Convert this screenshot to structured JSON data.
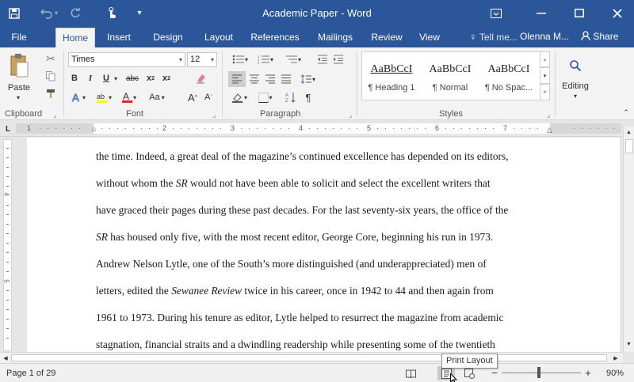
{
  "titlebar": {
    "title": "Academic Paper - Word",
    "save_icon": "save-icon",
    "undo_icon": "undo-icon",
    "redo_icon": "redo-icon",
    "touch_icon": "touch-mode-icon",
    "customize_icon": "customize-toolbar-icon",
    "ribbon_display_icon": "ribbon-display-options-icon"
  },
  "tabs": [
    {
      "label": "File"
    },
    {
      "label": "Home"
    },
    {
      "label": "Insert"
    },
    {
      "label": "Design"
    },
    {
      "label": "Layout"
    },
    {
      "label": "References"
    },
    {
      "label": "Mailings"
    },
    {
      "label": "Review"
    },
    {
      "label": "View"
    }
  ],
  "tellme": "Tell me...",
  "account": "Olenna M...",
  "share": "Share",
  "ribbon": {
    "clipboard": {
      "paste": "Paste",
      "label": "Clipboard"
    },
    "font": {
      "name": "Times",
      "size": "12",
      "label": "Font",
      "bold": "B",
      "italic": "I",
      "underline": "U",
      "strike": "abc",
      "subscript": "x",
      "superscript": "x",
      "case": "Aa",
      "grow": "A",
      "shrink": "A"
    },
    "paragraph": {
      "label": "Paragraph"
    },
    "styles": {
      "label": "Styles",
      "items": [
        {
          "sample": "AaBbCcI",
          "name": "¶ Heading 1"
        },
        {
          "sample": "AaBbCcI",
          "name": "¶ Normal"
        },
        {
          "sample": "AaBbCcI",
          "name": "¶ No Spac..."
        }
      ]
    },
    "editing": {
      "label": "Editing"
    }
  },
  "ruler": {
    "numbers": [
      "1",
      "2",
      "3",
      "4",
      "5",
      "6",
      "7"
    ]
  },
  "vruler": {
    "numbers": [
      "4",
      "5"
    ]
  },
  "document": {
    "lines": [
      {
        "parts": [
          "the time. Indeed, a great deal of the magazine’s continued excellence has depended on its editors,"
        ]
      },
      {
        "parts": [
          "without whom the ",
          "SR",
          " would not have been able to solicit and select the excellent writers that"
        ]
      },
      {
        "parts": [
          "have graced their pages during these past decades. For the last seventy-six years, the office of the"
        ]
      },
      {
        "parts": [
          "",
          "SR",
          " has housed only five, with the most recent editor, George Core, beginning his run in 1973."
        ]
      },
      {
        "parts": [
          "Andrew Nelson Lytle, one of the South’s more distinguished (and underappreciated) men of"
        ]
      },
      {
        "parts": [
          "letters, edited the ",
          "Sewanee Review",
          " twice in his career, once in 1942 to 44 and then again from"
        ]
      },
      {
        "parts": [
          "1961 to 1973. During his tenure as editor, Lytle helped to resurrect the magazine from academic"
        ]
      },
      {
        "parts": [
          "stagnation, financial straits and a dwindling readership while presenting some of the twentieth"
        ]
      }
    ]
  },
  "statusbar": {
    "page": "Page 1 of 29",
    "tooltip": "Print Layout",
    "zoom": "90%",
    "minus": "−",
    "plus": "+"
  }
}
